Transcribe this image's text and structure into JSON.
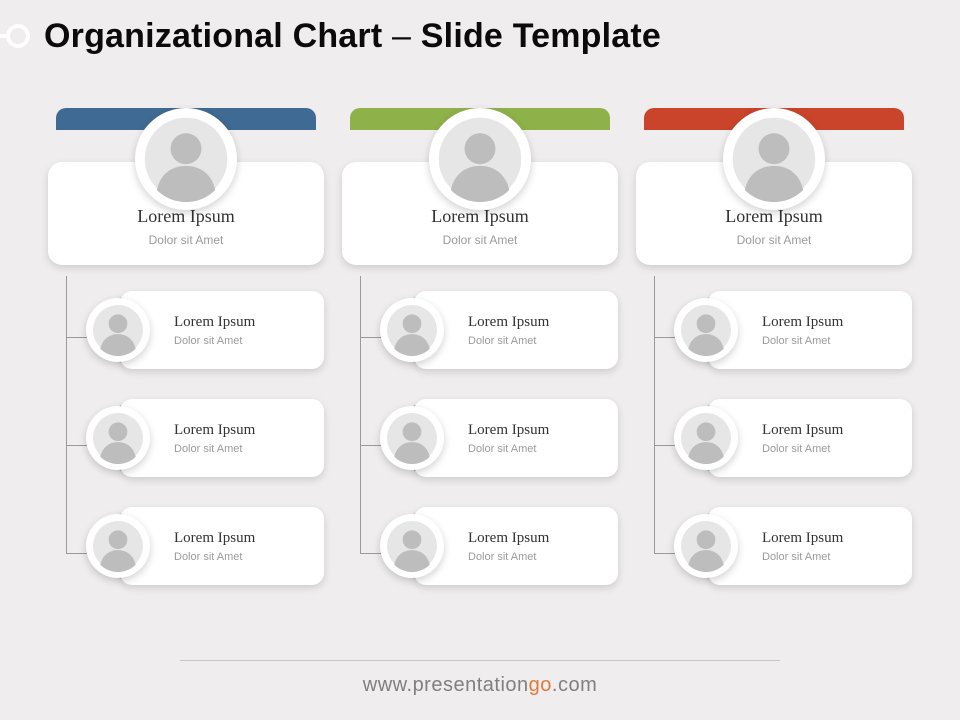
{
  "header": {
    "title_pre": "Organizational Chart",
    "title_post": "Slide Template"
  },
  "columns": [
    {
      "accent": "#3f6a93",
      "head": {
        "name": "Lorem Ipsum",
        "sub": "Dolor sit Amet"
      },
      "children": [
        {
          "accent": "#f0a23c",
          "name": "Lorem Ipsum",
          "sub": "Dolor sit Amet"
        },
        {
          "accent": "#3aa6d6",
          "name": "Lorem Ipsum",
          "sub": "Dolor sit Amet"
        },
        {
          "accent": "#f0a23c",
          "name": "Lorem Ipsum",
          "sub": "Dolor sit Amet"
        }
      ]
    },
    {
      "accent": "#8fb14a",
      "head": {
        "name": "Lorem Ipsum",
        "sub": "Dolor sit Amet"
      },
      "children": [
        {
          "accent": "#f0a23c",
          "name": "Lorem Ipsum",
          "sub": "Dolor sit Amet"
        },
        {
          "accent": "#2f5e8f",
          "name": "Lorem Ipsum",
          "sub": "Dolor sit Amet"
        },
        {
          "accent": "#f0a23c",
          "name": "Lorem Ipsum",
          "sub": "Dolor sit Amet"
        }
      ]
    },
    {
      "accent": "#c9442b",
      "head": {
        "name": "Lorem Ipsum",
        "sub": "Dolor sit Amet"
      },
      "children": [
        {
          "accent": "#f0a23c",
          "name": "Lorem Ipsum",
          "sub": "Dolor sit Amet"
        },
        {
          "accent": "#3aa6d6",
          "name": "Lorem Ipsum",
          "sub": "Dolor sit Amet"
        },
        {
          "accent": "#f0a23c",
          "name": "Lorem Ipsum",
          "sub": "Dolor sit Amet"
        }
      ]
    }
  ],
  "footer": {
    "text": "www.presentationgo.com"
  }
}
